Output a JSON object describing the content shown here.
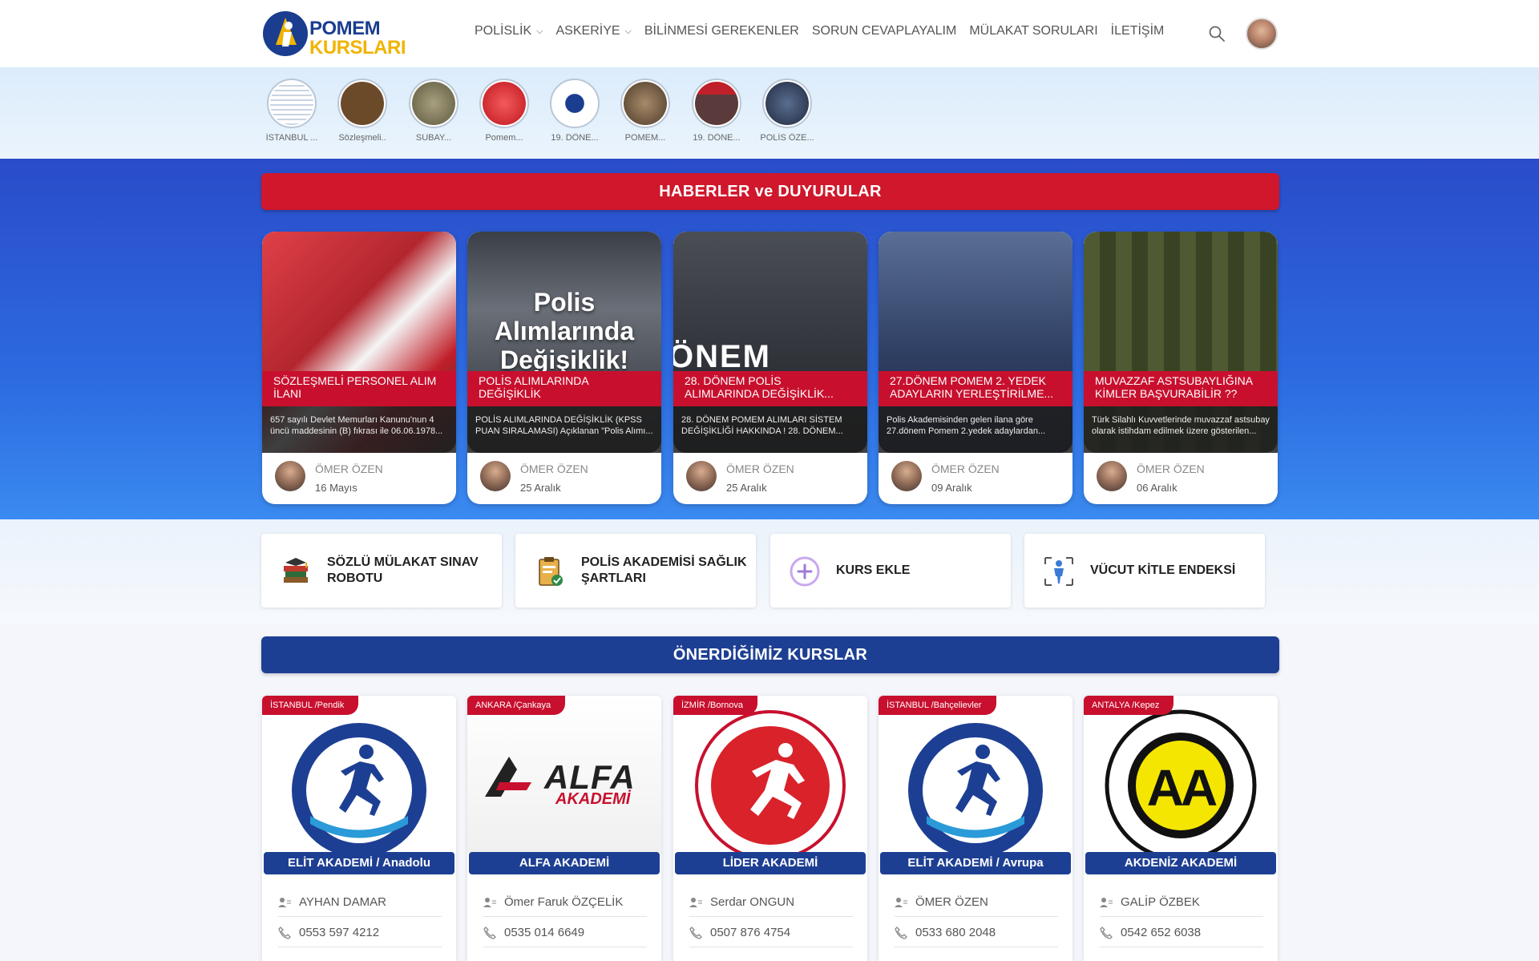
{
  "header": {
    "logo_line1": "POMEM",
    "logo_line2": "KURSLARI",
    "nav": [
      {
        "label": "POLİSLİK",
        "has_dropdown": true
      },
      {
        "label": "ASKERİYE",
        "has_dropdown": true
      },
      {
        "label": "BİLİNMESİ GEREKENLER",
        "has_dropdown": false
      },
      {
        "label": "SORUN CEVAPLAYALIM",
        "has_dropdown": false
      },
      {
        "label": "MÜLAKAT SORULARI",
        "has_dropdown": false
      },
      {
        "label": "İLETİŞİM",
        "has_dropdown": false
      }
    ],
    "search_icon": "search-icon"
  },
  "stories": [
    {
      "caption": "İSTANBUL ...",
      "color": "#dfe7f2"
    },
    {
      "caption": "Sözleşmeli..",
      "color": "#6b4a2a"
    },
    {
      "caption": "SUBAY...",
      "color": "#7d7a5c"
    },
    {
      "caption": "Pomem...",
      "color": "#d9222a"
    },
    {
      "caption": "19. DÖNE...",
      "color": "#ffffff"
    },
    {
      "caption": "POMEM...",
      "color": "#8a6a4c"
    },
    {
      "caption": "19. DÖNE...",
      "color": "#7a2a2a"
    },
    {
      "caption": "POLİS ÖZE...",
      "color": "#2c3a55"
    }
  ],
  "news": {
    "heading": "HABERLER ve DUYURULAR",
    "cards": [
      {
        "title": "SÖZLEŞMELİ PERSONEL ALIM İLANI",
        "excerpt": "657 sayılı Devlet Memurları Kanunu'nun 4 üncü maddesinin (B) fıkrası ile 06.06.1978...",
        "author": "ÖMER ÖZEN",
        "date": "16 Mayıs",
        "overlay_text": "",
        "img_color": "#b3262e"
      },
      {
        "title": "POLİS ALIMLARINDA DEĞİŞİKLİK",
        "excerpt": "POLİS ALIMLARINDA DEĞİŞİKLİK (KPSS PUAN SIRALAMASI) Açıklanan \"Polis Alımı...",
        "author": "ÖMER ÖZEN",
        "date": "25 Aralık",
        "overlay_text": "Polis Alımlarında Değişiklik!",
        "img_color": "#4a4f57"
      },
      {
        "title": "28. DÖNEM POLİS ALIMLARINDA DEĞİŞİKLİK...",
        "excerpt": "28. DÖNEM POMEM ALIMLARI SİSTEM DEĞİŞİKLİĞİ HAKKINDA ! 28. DÖNEM...",
        "author": "ÖMER ÖZEN",
        "date": "25 Aralık",
        "overlay_text": "ÖNEM",
        "img_color": "#2b2f36"
      },
      {
        "title": "27.DÖNEM POMEM 2. YEDEK ADAYLARIN YERLEŞTİRİLME...",
        "excerpt": "Polis Akademisinden gelen ilana göre 27.dönem Pomem 2.yedek adaylardan...",
        "author": "ÖMER ÖZEN",
        "date": "09 Aralık",
        "overlay_text": "",
        "img_color": "#2f3f63"
      },
      {
        "title": "MUVAZZAF ASTSUBAYLIĞINA KİMLER BAŞVURABİLİR ??",
        "excerpt": "Türk Silahlı Kuvvetlerinde muvazzaf astsubay olarak istihdam edilmek üzere gösterilen...",
        "author": "ÖMER ÖZEN",
        "date": "06 Aralık",
        "overlay_text": "",
        "img_color": "#4f5a33"
      }
    ]
  },
  "quick_links": [
    {
      "label": "SÖZLÜ MÜLAKAT SINAV ROBOTU",
      "icon": "books-icon"
    },
    {
      "label": "POLİS AKADEMİSİ SAĞLIK ŞARTLARI",
      "icon": "medical-clipboard-icon"
    },
    {
      "label": "KURS EKLE",
      "icon": "plus-circle-icon"
    },
    {
      "label": "VÜCUT KİTLE ENDEKSİ",
      "icon": "body-scan-icon"
    }
  ],
  "courses": {
    "heading": "ÖNERDİĞİMİZ KURSLAR",
    "items": [
      {
        "location": "İSTANBUL /Pendik",
        "name": "ELİT AKADEMİ / Anadolu",
        "contact": "AYHAN DAMAR",
        "phone": "0553 597 4212",
        "logo": "elit"
      },
      {
        "location": "ANKARA /Çankaya",
        "name": "ALFA AKADEMİ",
        "contact": "Ömer Faruk ÖZÇELİK",
        "phone": "0535 014 6649",
        "logo": "alfa"
      },
      {
        "location": "İZMİR /Bornova",
        "name": "LİDER AKADEMİ",
        "contact": "Serdar ONGUN",
        "phone": "0507 876 4754",
        "logo": "lider"
      },
      {
        "location": "İSTANBUL /Bahçelievler",
        "name": "ELİT AKADEMİ / Avrupa",
        "contact": "ÖMER ÖZEN",
        "phone": "0533 680 2048",
        "logo": "elit"
      },
      {
        "location": "ANTALYA /Kepez",
        "name": "AKDENİZ AKADEMİ",
        "contact": "GALİP ÖZBEK",
        "phone": "0542 652 6038",
        "logo": "akdeniz"
      }
    ],
    "logo_texts": {
      "alfa_big": "ALFA",
      "alfa_small": "AKADEMİ",
      "akdeniz": "AA"
    }
  }
}
